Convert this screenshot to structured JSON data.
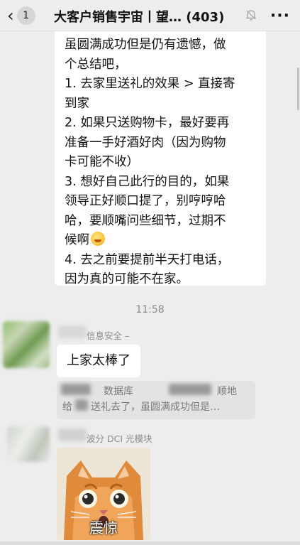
{
  "header": {
    "back_count": "1",
    "title": "大客户销售宇宙丨望… (403)",
    "more_label": "···"
  },
  "messages": {
    "summary_bubble": {
      "lines": [
        "虽圆满成功但是仍有遗憾，做",
        "个总结吧，",
        "1. 去家里送礼的效果 > 直接寄",
        "到家",
        "2. 如果只送购物卡，最好要再",
        "准备一手好酒好肉（因为购物",
        "卡可能不收）",
        "3. 想好自己此行的目的，如果",
        "领导正好顺口提了，别哼哼哈",
        "哈，要顺嘴问些细节，过期不",
        "候啊",
        "4. 去之前要提前半天打电话，",
        "因为真的可能不在家。"
      ]
    },
    "timestamp": "11:58",
    "reply": {
      "sender_suffix": "信息安全 –",
      "text": "上家太棒了",
      "quote_line1": "数据库",
      "quote_line1_tail": "顺地",
      "quote_line2_head": "给",
      "quote_line2": "送礼去了，虽圆满成功但是…"
    },
    "image_message": {
      "sender_suffix": "波分 DCI 光模块",
      "caption": "震惊"
    }
  },
  "colors": {
    "background": "#ededed",
    "bubble": "#ffffff",
    "quote_bg": "#e3e3e3",
    "muted_text": "#8a8a8a"
  }
}
